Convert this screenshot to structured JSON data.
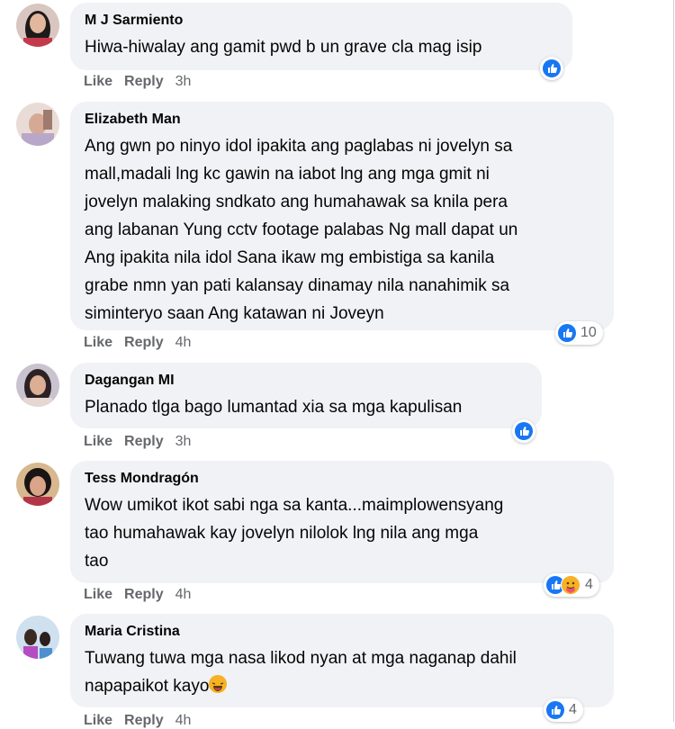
{
  "comments": [
    {
      "author": "M J Sarmiento",
      "text": "Hiwa-hiwalay ang gamit pwd b un grave cla mag isip",
      "like": "Like",
      "reply": "Reply",
      "time": "3h",
      "reaction_count": ""
    },
    {
      "author": "Elizabeth Man",
      "text": "Ang gwn po ninyo idol ipakita ang paglabas ni jovelyn sa\nmall,madali lng kc gawin na iabot lng ang mga gmit ni\njovelyn malaking sndkato ang humahawak sa knila pera\nang labanan Yung cctv footage palabas Ng mall dapat un\nAng ipakita nila idol Sana ikaw mg embistiga sa kanila\ngrabe nmn yan pati kalansay dinamay nila nanahimik sa\nsiminteryo saan Ang katawan ni Joveyn",
      "like": "Like",
      "reply": "Reply",
      "time": "4h",
      "reaction_count": "10"
    },
    {
      "author": "Dagangan MI",
      "text": "Planado tlga bago lumantad xia sa mga kapulisan",
      "like": "Like",
      "reply": "Reply",
      "time": "3h",
      "reaction_count": ""
    },
    {
      "author": "Tess Mondragón",
      "text": "Wow umikot ikot sabi nga sa kanta...maimplowensyang\ntao humahawak kay jovelyn nilolok lng nila ang mga\ntao",
      "like": "Like",
      "reply": "Reply",
      "time": "4h",
      "reaction_count": "4"
    },
    {
      "author": "Maria Cristina",
      "text": "Tuwang tuwa mga nasa likod nyan at mga naganap dahil\nnapapaikot kayo",
      "like": "Like",
      "reply": "Reply",
      "time": "4h",
      "reaction_count": "4"
    }
  ],
  "colors": {
    "bubble": "#f0f2f5",
    "like_blue": "#1877f2",
    "meta_gray": "#65676b"
  }
}
